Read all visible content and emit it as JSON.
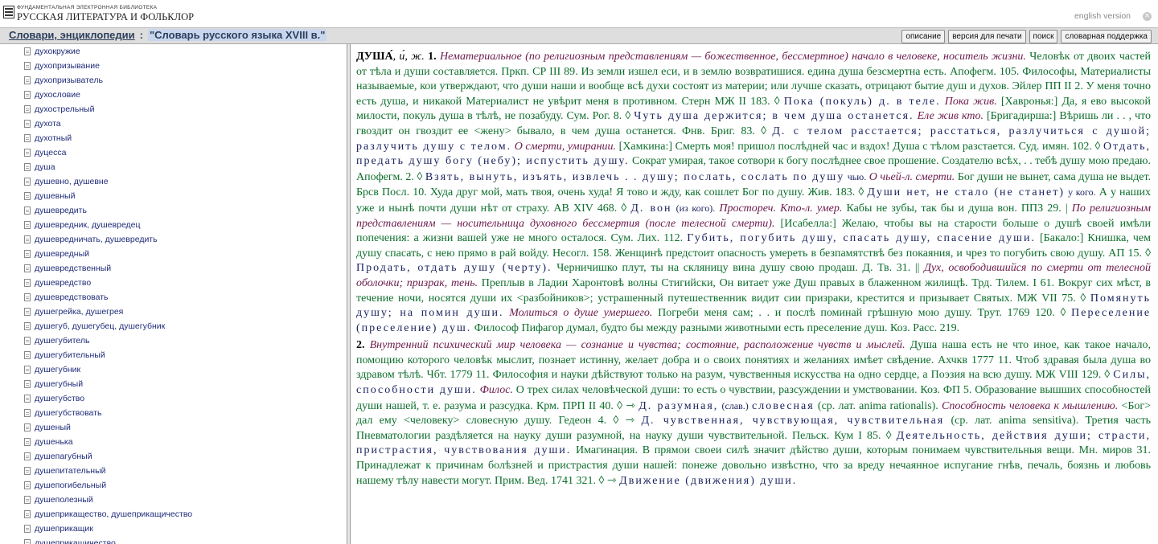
{
  "header": {
    "logo_line1": "ФУНДАМЕНТАЛЬНАЯ ЭЛЕКТРОННАЯ БИБЛИОТЕКА",
    "logo_line2": "РУССКАЯ ЛИТЕРАТУРА И ФОЛЬКЛОР",
    "version_link": "english version",
    "close_symbol": "×"
  },
  "navbar": {
    "crumb_section": "Словари, энциклопедии",
    "crumb_separator": ":",
    "crumb_current": "\"Словарь русского языка XVIII в.\"",
    "buttons": [
      "описание",
      "версия для печати",
      "поиск",
      "словарная поддержка"
    ]
  },
  "sidebar": {
    "items": [
      "духокружие",
      "духопризывание",
      "духопризыватель",
      "духословие",
      "духострельный",
      "духота",
      "духотный",
      "дуцесса",
      "душа",
      "душевно, душевне",
      "душевный",
      "душевредить",
      "душевредник, душевредец",
      "душевредничать, душевредить",
      "душевредный",
      "душевредственный",
      "душевредство",
      "душевредствовать",
      "душегрейка, душегрея",
      "душегуб, душегубец, душегубник",
      "душегубитель",
      "душегубительный",
      "душегубник",
      "душегубный",
      "душегубство",
      "душегубствовать",
      "душеный",
      "душенька",
      "душепагубный",
      "душепитательный",
      "душепогибельный",
      "душеполезный",
      "душеприкащество, душеприкащичество",
      "душеприкащик",
      "душеприкащичество"
    ]
  },
  "article": {
    "s1": {
      "hw": "ДУША́",
      "gram": ", и́, ж.",
      "num": "1.",
      "def1": "Нематериальное (по религиозным представлениям — божественное, бессмертное) начало в человеке, носитель жизни.",
      "t1": "Человѣк от двоих частей от тѣла и души составляется. Пркп. СР III 89. Из земли изшел еси, и в землю возвратишися. едина душа безсмертна есть. Апофегм. 105. Философы, Материалисты называемые, кои утверждают, что души наши и вообще всѣ духи состоят из материи; или лучше сказать, отрицают бытие душ и духов. Эйлер ПП II 2. У меня точно есть душа, и никакой Материалист не увѣрит меня в противном. Стерн МЖ II 183. ◊",
      "p1": "Пока (покуль) д. в теле.",
      "d2": "Пока жив.",
      "t2": "[Хавронья:] Да, я ево высокой милости, покуль душа в тѣлѣ, не позабуду. Сум. Рог. 8. ◊",
      "p2": "Чуть душа держится; в чем душа останется.",
      "d3": "Еле жив кто.",
      "t3": "[Бригадирша:] Вѣришь ли . . , что гвоздит он гвоздит ее <жену> бывало, в чем душа останется. Фнв. Бриг. 83. ◊",
      "p3": "Д. с телом расстается; расстаться, разлучиться с душой; разлучить душу с телом.",
      "d4": "О смерти, умирании.",
      "t4": "[Хамкина:] Смерть моя! пришол послѣдней час и вздох! Душа с тѣлом разстается. Суд. имян. 102. ◊",
      "p4": "Отдать, предать душу богу (небу); испустить душу.",
      "t5": "Сократ умирая, такое сотвори к богу послѣднее свое прошение. Создателю всѣх, . . тебѣ душу мою предаю. Апофегм. 2. ◊",
      "p5": "Взять, вынуть, изъять, извлечь . . душу; послать, сослать по душу",
      "g1": "чью.",
      "d5": "О чьей-л. смерти.",
      "t6": "Бог души не вынет, сама душа не выдет. Брсв Посл. 10. Худа друг мой, мать твоя, очень худа! Я тово и жду, как сошлет Бог по душу. Жив. 183. ◊",
      "p6": "Души нет, не стало (не станет)",
      "g2": "у кого.",
      "t7": "А у наших уже и нынѣ почти души нѣт от страху. АВ XIV 468. ◊",
      "p7": "Д. вон",
      "g3": "(из кого).",
      "d6": "Простореч. Кто-л. умер.",
      "t8": "Кабы не зубы, так бы и душа вон. ППЗ 29. |",
      "d7": "По религиозным представлениям — носительница духовного бессмертия (после телесной смерти).",
      "t9": "[Исабелла:] Желаю, чтобы вы на старости больше о душѣ своей имѣли попечения: а жизни вашей уже не много осталося. Сум. Лих. 112.",
      "p8": "Губить, погубить душу, спасать душу, спасение души.",
      "t10": "[Бакало:] Книшка, чем душу спасать, с нею прямо в рай войду. Несогл. 158. Женщинѣ предстоит опасность умереть в безпамятствѣ без покаяния, и чрез то погубить свою душу. АП 15. ◊",
      "p9": "Продать, отдать душу (черту).",
      "t11": "Черничишко плут, ты на скляницу вина душу свою продаш. Д. Тв. 31. ||",
      "d8": "Дух, освободившийся по смерти от телесной оболочки; призрак, тень.",
      "t12": "Преплыв в Ладии Харонтовѣ волны Стигийски, Он витает уже Душ правых в блаженном жилищѣ. Трд. Тилем. I 61. Вокруг сих мѣст, в течение ночи, носятся души их <разбойников>; устрашенный путешественник видит сии призраки, крестится и призывает Святых. МЖ VII 75. ◊",
      "p10": "Помянуть душу; на помин души.",
      "d9": "Молиться о душе умершего.",
      "t13": "Погреби меня сам; . . и послѣ поминай грѣшную мою душу. Трут. 1769 120. ◊",
      "p11": "Переселение (преселение) душ.",
      "t14": "Философ Пифагор думал, будто бы между разными животными есть преселение душ. Коз. Расс. 219."
    },
    "s2": {
      "num": "2.",
      "def1": "Внутренний психический мир человека — сознание и чувства; состояние, расположение чувств и мыслей.",
      "t1": "Душа наша есть не что иное, как такое начало, помощию которого человѣк мыслит, познает истинну, желает добра и о своих понятиях и желаниях имѣет свѣдение. Ахчкв 1777 11. Чтоб здравая была душа во здравом тѣлѣ. Чбт. 1779 11. Философия и науки дѣйствуют только на разум, чувственныя искусства на одно сердце, а Поэзия на всю душу. МЖ VIII 129. ◊",
      "p1": "Силы, способности души.",
      "d2": "Филос.",
      "t2": "О трех силах человѣческой души: то есть о чувствии, разсуждении и умствовании. Коз. ФП 5. Образование вышших способностей души нашей, т. е. разума и разсудка. Крм. ПРП II 40. ◊ ⇾",
      "p2": "Д. разумная,",
      "g1": "(слав.)",
      "p3": "словесная",
      "t3": "(ср. лат. anima rationalis).",
      "d3": "Способность человека к мышлению.",
      "t4": "<Бог> дал ему <человеку> словесную душу. Гедеон 4. ◊ ⇾",
      "p4": "Д. чувственная, чувствующая, чувствительная",
      "t5": "(ср. лат. anima sensitiva). Третия часть Пневматологии раздѣляется на науку души разумной, на науку души чувствительной. Пельск. Кум I 85. ◊",
      "p5": "Деятельность, действия души; страсти, пристрастия, чувствования души.",
      "t6": "Имагинация. В прямои своеи силѣ значит дѣйство души, которым понимаем чувствительныя вещи. Мн. миров 31. Принадлежат к причинам болѣзней и пристрастия души нашей: понеже довольно извѣстно, что за вреду нечаянное испугание гнѣв, печаль, боязнь и любовь нашему тѣлу навести могут. Прим. Вед. 1741 321. ◊ ⇾",
      "p6": "Движение (движения) души."
    }
  }
}
